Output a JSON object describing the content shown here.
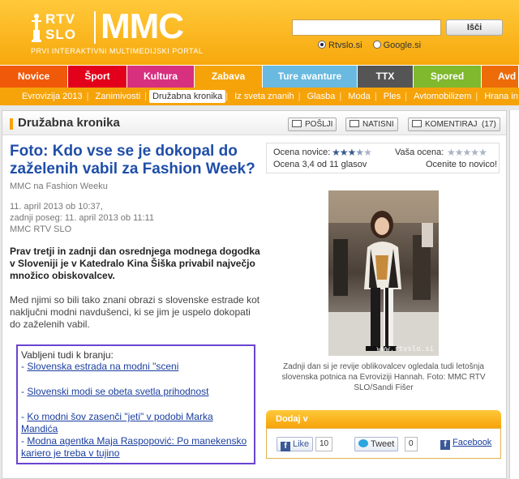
{
  "header": {
    "logo_rtv_1": "RTV",
    "logo_rtv_2": "SLO",
    "logo_mmc": "MMC",
    "tagline": "PRVI INTERAKTIVNI MULTIMEDIJSKI PORTAL",
    "search_value": "",
    "search_button": "Išči",
    "radio_1": "Rtvslo.si",
    "radio_2": "Google.si",
    "radio_selected": "Rtvslo.si"
  },
  "nav": {
    "tabs": [
      {
        "label": "Novice",
        "color": "#f0590a"
      },
      {
        "label": "Šport",
        "color": "#e2001a"
      },
      {
        "label": "Kultura",
        "color": "#d6307f"
      },
      {
        "label": "Zabava",
        "color": "#f6a30a"
      },
      {
        "label": "Ture avanture",
        "color": "#69b9e0"
      },
      {
        "label": "TTX",
        "color": "#555555"
      },
      {
        "label": "Spored",
        "color": "#80b82e"
      },
      {
        "label": "Avd",
        "color": "#ed6b08"
      }
    ]
  },
  "subnav": {
    "items": [
      "Evrovizija 2013",
      "Zanimivosti",
      "Družabna kronika",
      "Iz sveta znanih",
      "Glasba",
      "Moda",
      "Ples",
      "Avtomobilizem",
      "Hrana in p"
    ],
    "active": "Družabna kronika"
  },
  "section": {
    "title": "Družabna kronika",
    "btn_send": "POŠLJI",
    "btn_print": "NATISNI",
    "btn_comment": "KOMENTIRAJ",
    "comment_count": "(17)"
  },
  "article": {
    "headline": "Foto: Kdo vse se je dokopal do zaželenih vabil za Fashion Week?",
    "byline": "MMC na Fashion Weeku",
    "date_line1": "11. april 2013 ob 10:37,",
    "date_line2": "zadnji poseg: 11. april 2013 ob 11:11",
    "source": "MMC RTV SLO",
    "lead": "Prav tretji in zadnji dan osrednjega modnega dogodka v Sloveniji je v Katedralo Kina Šiška privabil največjo množico obiskovalcev.",
    "paragraph": "Med njimi so bili tako znani obrazi s slovenske estrade kot naključni modni navdušenci, ki se jim je uspelo dokopati do zaželenih vabil."
  },
  "related": {
    "label": "Vabljeni tudi k branju:",
    "links": [
      "Slovenska estrada na modni \"sceni",
      "Slovenski modi se obeta svetla prihodnost",
      "Ko modni šov zasenči \"jeti\" v podobi Marka Mandića",
      "Modna agentka Maja Raspopović: Po manekensko kariero je treba v tujino"
    ]
  },
  "rating": {
    "label_reader": "Ocena novice:",
    "stars_reader": 3.4,
    "score_text": "Ocena 3,4 od 11 glasov",
    "label_yours": "Vaša ocena:",
    "cta": "Ocenite to novico!"
  },
  "photo": {
    "watermark": "www.rtvslo.si",
    "caption": "Zadnji dan si je revije oblikovalcev ogledala tudi letošnja slovenska potnica na Evroviziji Hannah. Foto: MMC RTV SLO/Sandi Fišer"
  },
  "share": {
    "title": "Dodaj v",
    "like_label": "Like",
    "like_count": "10",
    "tweet_label": "Tweet",
    "tweet_count": "0",
    "facebook_label": "Facebook"
  }
}
